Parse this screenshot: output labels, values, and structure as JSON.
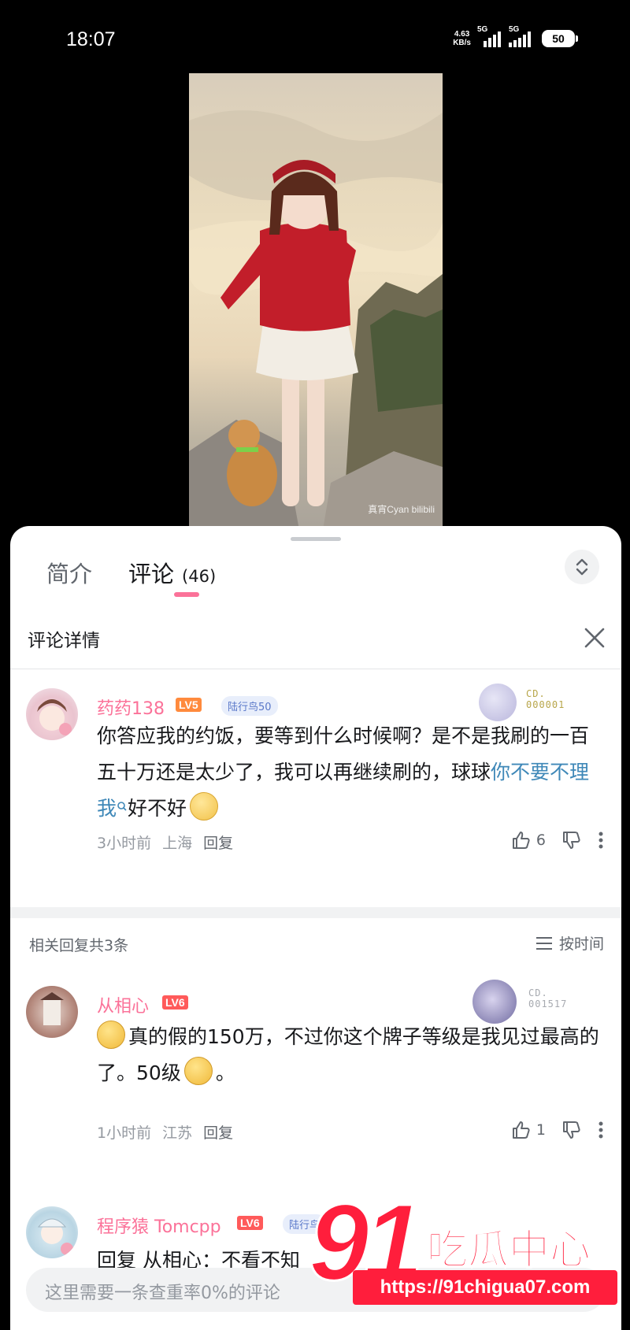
{
  "status_bar": {
    "time": "18:07",
    "speed_value": "4.63",
    "speed_unit": "KB/s",
    "net_label_1": "5G",
    "net_label_2": "5G",
    "battery": "50"
  },
  "video": {
    "watermark": "真宵Cyan bilibili"
  },
  "tabs": {
    "intro": "简介",
    "comments": "评论",
    "comment_count": "(46)"
  },
  "detail": {
    "title": "评论详情"
  },
  "main_comment": {
    "username": "药药138",
    "level": "LV5",
    "medal": "陆行鸟50",
    "fan_badge_line1": "CD.",
    "fan_badge_line2": "000001",
    "text_before": "你答应我的约饭，要等到什么时候啊？是不是我刷的一百五十万还是太少了，我可以再继续刷的，球球",
    "text_link": "你不要不理我",
    "text_after": "好不好",
    "time": "3小时前",
    "location": "上海",
    "reply_label": "回复",
    "likes": "6"
  },
  "related": {
    "label": "相关回复共3条",
    "sort_label": "按时间"
  },
  "reply_1": {
    "username": "从相心",
    "level": "LV6",
    "fan_badge_line1": "CD.",
    "fan_badge_line2": "001517",
    "text_1": "真的假的150万，不过你这个牌子等级是我见过最高的了。50级",
    "text_2": "。",
    "time": "1小时前",
    "location": "江苏",
    "reply_label": "回复",
    "likes": "1"
  },
  "reply_2": {
    "username": "程序猿 Tomcpp",
    "level": "LV6",
    "medal": "陆行鸟",
    "text": "回复 从相心：不看不知"
  },
  "input": {
    "placeholder": "这里需要一条查重率0%的评论"
  },
  "brand": {
    "number": "91",
    "name": "吃瓜中心",
    "url": "https://91chigua07.com"
  },
  "colors": {
    "accent": "#fb7299",
    "link": "#3f88b8",
    "brand_red": "#ff1e3c"
  }
}
